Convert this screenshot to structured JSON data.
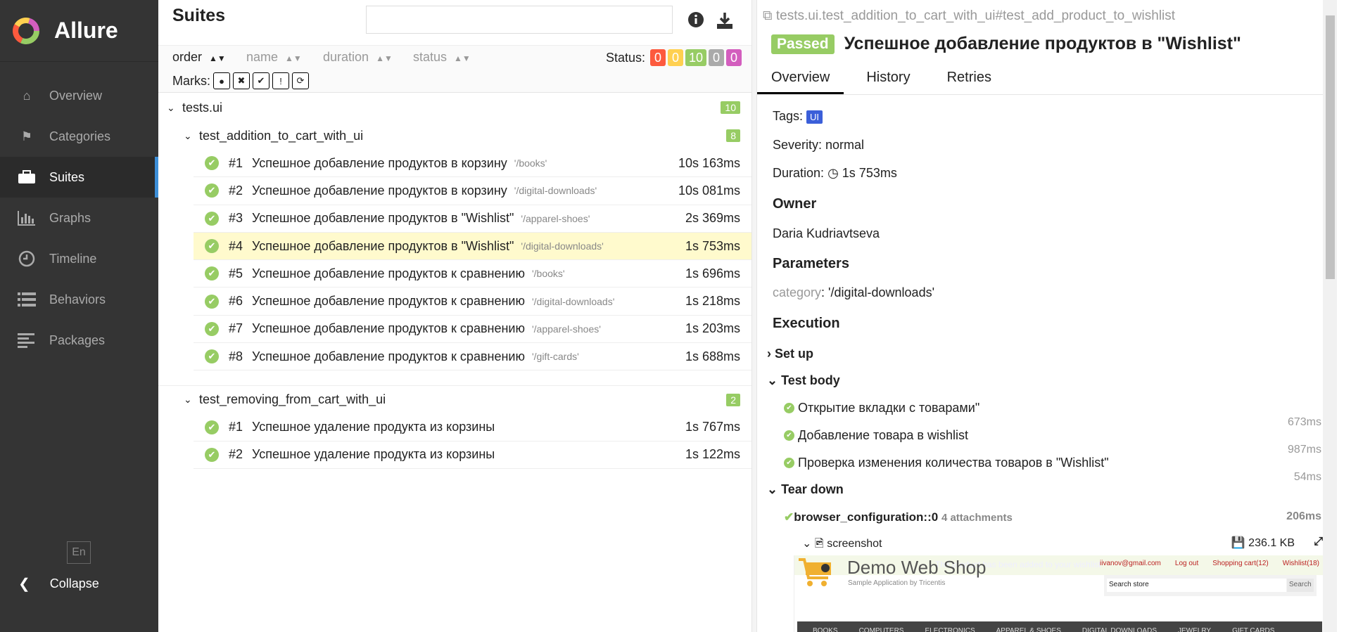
{
  "sidebar": {
    "app_name": "Allure",
    "items": [
      {
        "label": "Overview",
        "icon": "home-icon"
      },
      {
        "label": "Categories",
        "icon": "flag-icon"
      },
      {
        "label": "Suites",
        "icon": "briefcase-icon",
        "active": true
      },
      {
        "label": "Graphs",
        "icon": "bar-chart-icon"
      },
      {
        "label": "Timeline",
        "icon": "clock-icon"
      },
      {
        "label": "Behaviors",
        "icon": "list-icon"
      },
      {
        "label": "Packages",
        "icon": "align-left-icon"
      }
    ],
    "language": "En",
    "collapse": "Collapse"
  },
  "suites": {
    "title": "Suites",
    "search_placeholder": "",
    "sort": {
      "order": "order",
      "name": "name",
      "duration": "duration",
      "status": "status"
    },
    "status_label": "Status:",
    "status_counts": [
      {
        "value": "0",
        "color": "#fd5a3e"
      },
      {
        "value": "0",
        "color": "#ffd050"
      },
      {
        "value": "10",
        "color": "#97cc64"
      },
      {
        "value": "0",
        "color": "#aaaaaa"
      },
      {
        "value": "0",
        "color": "#d35ebe"
      }
    ],
    "marks_label": "Marks:",
    "root": {
      "name": "tests.ui",
      "count": "10"
    },
    "groups": [
      {
        "name": "test_addition_to_cart_with_ui",
        "count": "8",
        "tests": [
          {
            "num": "#1",
            "name": "Успешное добавление продуктов в корзину",
            "param": "'/books'",
            "duration": "10s 163ms"
          },
          {
            "num": "#2",
            "name": "Успешное добавление продуктов в корзину",
            "param": "'/digital-downloads'",
            "duration": "10s 081ms"
          },
          {
            "num": "#3",
            "name": "Успешное добавление продуктов в \"Wishlist\"",
            "param": "'/apparel-shoes'",
            "duration": "2s 369ms"
          },
          {
            "num": "#4",
            "name": "Успешное добавление продуктов в \"Wishlist\"",
            "param": "'/digital-downloads'",
            "duration": "1s 753ms"
          },
          {
            "num": "#5",
            "name": "Успешное добавление продуктов к сравнению",
            "param": "'/books'",
            "duration": "1s 696ms"
          },
          {
            "num": "#6",
            "name": "Успешное добавление продуктов к сравнению",
            "param": "'/digital-downloads'",
            "duration": "1s 218ms"
          },
          {
            "num": "#7",
            "name": "Успешное добавление продуктов к сравнению",
            "param": "'/apparel-shoes'",
            "duration": "1s 203ms"
          },
          {
            "num": "#8",
            "name": "Успешное добавление продуктов к сравнению",
            "param": "'/gift-cards'",
            "duration": "1s 688ms"
          }
        ]
      },
      {
        "name": "test_removing_from_cart_with_ui",
        "count": "2",
        "tests": [
          {
            "num": "#1",
            "name": "Успешное удаление продукта из корзины",
            "param": "",
            "duration": "1s 767ms"
          },
          {
            "num": "#2",
            "name": "Успешное удаление продукта из корзины",
            "param": "",
            "duration": "1s 122ms"
          }
        ]
      }
    ]
  },
  "detail": {
    "path": "tests.ui.test_addition_to_cart_with_ui#test_add_product_to_wishlist",
    "status": "Passed",
    "title": "Успешное добавление продуктов в \"Wishlist\"",
    "tabs": [
      "Overview",
      "History",
      "Retries"
    ],
    "tags_label": "Tags:",
    "tag": "UI",
    "severity": "Severity: normal",
    "duration_label": "Duration:",
    "duration": "1s 753ms",
    "owner_heading": "Owner",
    "owner": "Daria Kudriavtseva",
    "params_heading": "Parameters",
    "param_name": "category",
    "param_value": ": '/digital-downloads'",
    "execution_heading": "Execution",
    "setup": "Set up",
    "test_body": "Test body",
    "steps": [
      {
        "name": "Открытие вкладки с товарами\"",
        "duration": "673ms"
      },
      {
        "name": "Добавление товара в wishlist",
        "duration": "987ms"
      },
      {
        "name": "Проверка изменения количества товаров в \"Wishlist\"",
        "duration": "54ms"
      }
    ],
    "teardown": "Tear down",
    "fixture": "browser_configuration::0",
    "fixture_attachments": "4 attachments",
    "fixture_duration": "206ms",
    "attachment": "screenshot",
    "attachment_size": "236.1 KB",
    "shot": {
      "logo": "Demo Web Shop",
      "subtitle": "Sample Application by Tricentis",
      "links": [
        "iivanov@gmail.com",
        "Log out",
        "Shopping cart(12)",
        "Wishlist(18)"
      ],
      "notification": "The product has been added to your wishlist",
      "search_placeholder": "Search store",
      "search_button": "Search",
      "menu": [
        "BOOKS",
        "COMPUTERS",
        "ELECTRONICS",
        "APPAREL & SHOES",
        "DIGITAL DOWNLOADS",
        "JEWELRY",
        "GIFT CARDS"
      ]
    }
  }
}
